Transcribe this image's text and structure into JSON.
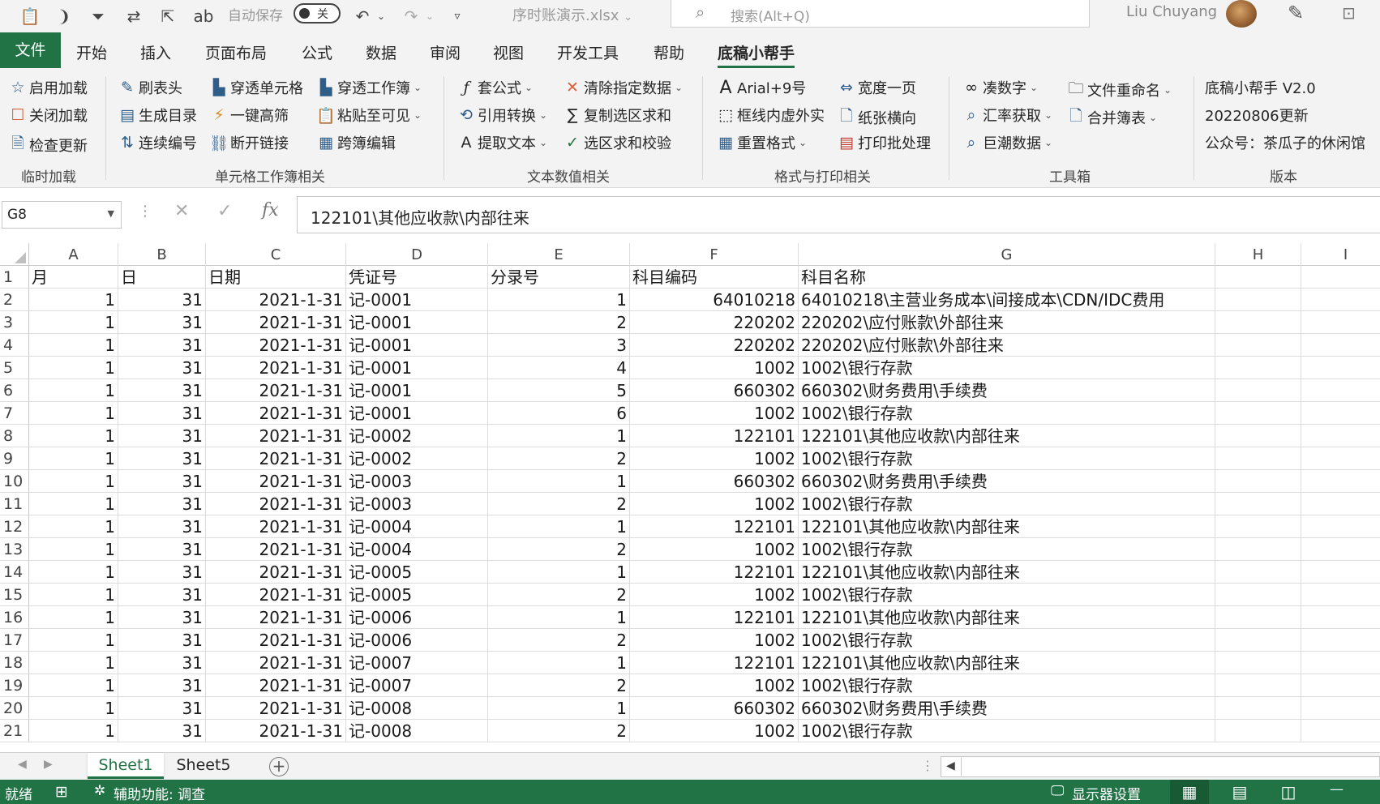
{
  "titlebar": {
    "autosave_label": "自动保存",
    "autosave_state": "关",
    "filename": "序时账演示.xlsx",
    "filename_caret": "⌄",
    "search_placeholder": "搜索(Alt+Q)",
    "user": "Liu Chuyang"
  },
  "tabs": [
    "文件",
    "开始",
    "插入",
    "页面布局",
    "公式",
    "数据",
    "审阅",
    "视图",
    "开发工具",
    "帮助",
    "底稿小帮手"
  ],
  "ribbon": {
    "groups": {
      "temp": "临时加载",
      "cell": "单元格工作簿相关",
      "text": "文本数值相关",
      "format": "格式与打印相关",
      "tools": "工具箱",
      "version": "版本"
    },
    "buttons": {
      "enable_load": "启用加载",
      "close_load": "关闭加载",
      "check_update": "检查更新",
      "refresh_header": "刷表头",
      "gen_toc": "生成目录",
      "serial_no": "连续编号",
      "drill_cell": "穿透单元格",
      "highlight": "一键高筛",
      "break_link": "断开链接",
      "drill_book": "穿透工作簿",
      "paste_visible": "粘贴至可见",
      "cross_edit": "跨簿编辑",
      "wrap_formula": "套公式",
      "ref_convert": "引用转换",
      "extract_text": "提取文本",
      "clear_data": "清除指定数据",
      "copy_sum": "复制选区求和",
      "sum_check": "选区求和校验",
      "font_preset": "Arial+9号",
      "border_style": "框线内虚外实",
      "reset_format": "重置格式",
      "fit_width": "宽度一页",
      "landscape": "纸张横向",
      "batch_print": "打印批处理",
      "round_num": "凑数字",
      "fx_rate": "汇率获取",
      "cninfo": "巨潮数据",
      "rename_file": "文件重命名",
      "merge_sheet": "合并簿表"
    },
    "version": {
      "name": "底稿小帮手 V2.0",
      "date": "20220806更新",
      "account": "公众号：茶瓜子的休闲馆"
    }
  },
  "formula_bar": {
    "name_box": "G8",
    "fx_label": "fx",
    "content": "122101\\其他应收款\\内部往来"
  },
  "columns": [
    "A",
    "B",
    "C",
    "D",
    "E",
    "F",
    "G",
    "H",
    "I"
  ],
  "header_row": [
    "月",
    "日",
    "日期",
    "凭证号",
    "分录号",
    "科目编码",
    "科目名称"
  ],
  "rows": [
    [
      1,
      31,
      "2021-1-31",
      "记-0001",
      1,
      "64010218",
      "64010218\\主营业务成本\\间接成本\\CDN/IDC费用"
    ],
    [
      1,
      31,
      "2021-1-31",
      "记-0001",
      2,
      "220202",
      "220202\\应付账款\\外部往来"
    ],
    [
      1,
      31,
      "2021-1-31",
      "记-0001",
      3,
      "220202",
      "220202\\应付账款\\外部往来"
    ],
    [
      1,
      31,
      "2021-1-31",
      "记-0001",
      4,
      "1002",
      "1002\\银行存款"
    ],
    [
      1,
      31,
      "2021-1-31",
      "记-0001",
      5,
      "660302",
      "660302\\财务费用\\手续费"
    ],
    [
      1,
      31,
      "2021-1-31",
      "记-0001",
      6,
      "1002",
      "1002\\银行存款"
    ],
    [
      1,
      31,
      "2021-1-31",
      "记-0002",
      1,
      "122101",
      "122101\\其他应收款\\内部往来"
    ],
    [
      1,
      31,
      "2021-1-31",
      "记-0002",
      2,
      "1002",
      "1002\\银行存款"
    ],
    [
      1,
      31,
      "2021-1-31",
      "记-0003",
      1,
      "660302",
      "660302\\财务费用\\手续费"
    ],
    [
      1,
      31,
      "2021-1-31",
      "记-0003",
      2,
      "1002",
      "1002\\银行存款"
    ],
    [
      1,
      31,
      "2021-1-31",
      "记-0004",
      1,
      "122101",
      "122101\\其他应收款\\内部往来"
    ],
    [
      1,
      31,
      "2021-1-31",
      "记-0004",
      2,
      "1002",
      "1002\\银行存款"
    ],
    [
      1,
      31,
      "2021-1-31",
      "记-0005",
      1,
      "122101",
      "122101\\其他应收款\\内部往来"
    ],
    [
      1,
      31,
      "2021-1-31",
      "记-0005",
      2,
      "1002",
      "1002\\银行存款"
    ],
    [
      1,
      31,
      "2021-1-31",
      "记-0006",
      1,
      "122101",
      "122101\\其他应收款\\内部往来"
    ],
    [
      1,
      31,
      "2021-1-31",
      "记-0006",
      2,
      "1002",
      "1002\\银行存款"
    ],
    [
      1,
      31,
      "2021-1-31",
      "记-0007",
      1,
      "122101",
      "122101\\其他应收款\\内部往来"
    ],
    [
      1,
      31,
      "2021-1-31",
      "记-0007",
      2,
      "1002",
      "1002\\银行存款"
    ],
    [
      1,
      31,
      "2021-1-31",
      "记-0008",
      1,
      "660302",
      "660302\\财务费用\\手续费"
    ],
    [
      1,
      31,
      "2021-1-31",
      "记-0008",
      2,
      "1002",
      "1002\\银行存款"
    ]
  ],
  "sheets": [
    "Sheet1",
    "Sheet5"
  ],
  "statusbar": {
    "ready": "就绪",
    "accessibility": "辅助功能: 调查",
    "display_settings": "显示器设置"
  },
  "colors": {
    "accent": "#217346",
    "ribbon_bg": "#f3f3f3"
  }
}
